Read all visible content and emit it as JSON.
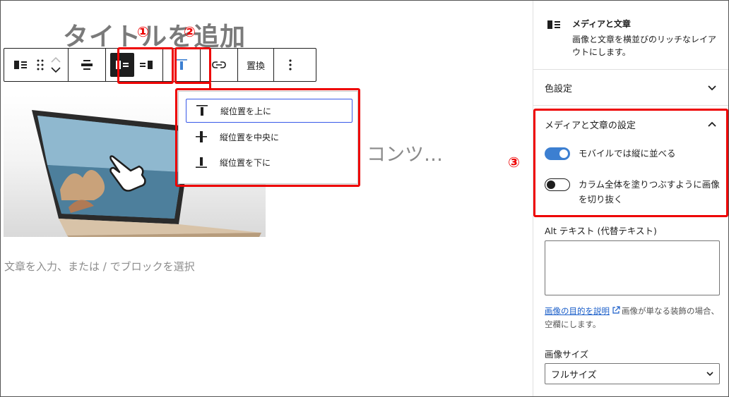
{
  "editor": {
    "title_placeholder": "タイトルを追加",
    "content_placeholder": "コンツ…",
    "paragraph_placeholder": "文章を入力、または / でブロックを選択"
  },
  "toolbar": {
    "replace_label": "置換"
  },
  "vertical_align_menu": {
    "items": [
      {
        "label": "縦位置を上に",
        "icon": "align-top-icon"
      },
      {
        "label": "縦位置を中央に",
        "icon": "align-center-icon"
      },
      {
        "label": "縦位置を下に",
        "icon": "align-bottom-icon"
      }
    ]
  },
  "annotations": {
    "marker1": "①",
    "marker2": "②",
    "marker3": "③",
    "color": "#e00000"
  },
  "sidebar": {
    "block": {
      "title": "メディアと文章",
      "description": "画像と文章を横並びのリッチなレイアウトにします。"
    },
    "color_panel": "色設定",
    "settings_panel": {
      "title": "メディアと文章の設定",
      "stack_mobile": {
        "label": "モバイルでは縦に並べる",
        "checked": true
      },
      "crop_fill": {
        "label": "カラム全体を塗りつぶすように画像を切り抜く",
        "checked": false
      }
    },
    "alt": {
      "label": "Alt テキスト (代替テキスト)",
      "help_link": "画像の目的を説明",
      "help_text": "画像が単なる装飾の場合、空欄にします。"
    },
    "image_size": {
      "label": "画像サイズ",
      "value": "フルサイズ"
    }
  },
  "colors": {
    "accent": "#3858e9",
    "toggle_on": "#3c7fd1",
    "dark": "#1e1e1e"
  }
}
